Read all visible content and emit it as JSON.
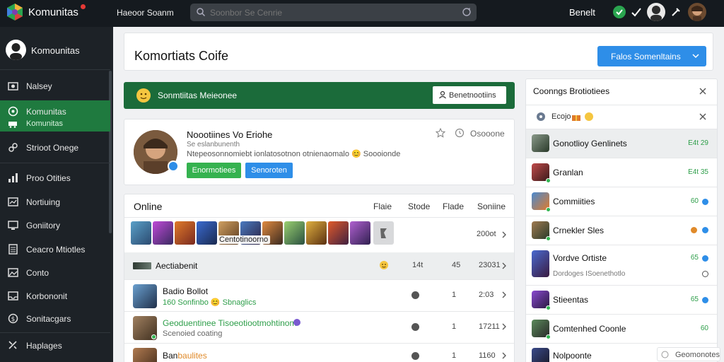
{
  "topbar": {
    "brand": "Komunitas",
    "nav": "Haeoor Soanm",
    "search_placeholder": "Soonbor Se Cenrie",
    "user_name": "Benelt"
  },
  "sidebar": {
    "profile_name": "Komounitas",
    "items": [
      {
        "label": "Nalsey"
      },
      {
        "label": "Komunitas",
        "sub": "Komunitas"
      },
      {
        "label": "Strioot Onege"
      },
      {
        "label": "Proo Otities"
      },
      {
        "label": "Nortiuing"
      },
      {
        "label": "Goniitory"
      },
      {
        "label": "Ceacro Mtiotles"
      },
      {
        "label": "Conto"
      },
      {
        "label": "Korbononit"
      },
      {
        "label": "Sonitacgars"
      },
      {
        "label": "Haplages"
      }
    ]
  },
  "header": {
    "title": "Komortiats Coife",
    "primary_button": "Falos Somenltains"
  },
  "banner": {
    "text": "Sonmtiitas Meieonee",
    "button": "Benetnootiins"
  },
  "profile_card": {
    "name": "Noootiines Vo Eriohe",
    "line1": "Se eslanbunenth",
    "line2": "Ntepeosonnomiebt ionlatosotnon otnienaomalo 😊 Soooionde",
    "button_green": "Enormotiees",
    "button_blue": "Senoroten",
    "stat": "Osooone"
  },
  "online": {
    "heading": "Online",
    "columns": [
      "Flaie",
      "Stode",
      "Flade",
      "Soniine"
    ],
    "thumb_label": "Centotinoorno",
    "count": "200ot",
    "rows": [
      {
        "name": "Aectiabenit",
        "c0": "14t",
        "c1": "45",
        "c2": "23031"
      },
      {
        "name": "Badio Bollot",
        "sub": "160 Sonfinbo 😊 Sbnaglics",
        "c1": "1",
        "c2": "2:03"
      },
      {
        "name": "Geoduentinee Tisoeotiootmohtinom",
        "sub": "Scenoied coating",
        "c1": "1",
        "c2": "17211"
      },
      {
        "name": "Ban",
        "name_hl": "baulites",
        "c1": "1",
        "c2": "1160"
      }
    ]
  },
  "right_panel": {
    "title": "Coonngs Brotiotiees",
    "filter_label": "Ecojo",
    "items": [
      {
        "name": "Gonotlioy Genlinets",
        "value": "E4t 29"
      },
      {
        "name": "Granlan",
        "value": "E4t 35"
      },
      {
        "name": "Commiities",
        "value": "60"
      },
      {
        "name": "Crnekler Sles",
        "value": ""
      },
      {
        "name": "Vordve Ortiste",
        "sub": "Dordoges ISoenethotlo",
        "value": "65"
      },
      {
        "name": "Stieentas",
        "value": "65"
      },
      {
        "name": "Comtenhed Coonle",
        "value": "60"
      },
      {
        "name": "Nolpoonte",
        "value": ""
      }
    ],
    "float_button": "Geomonotes"
  },
  "colors": {
    "accent_green": "#1f7a3f",
    "accent_blue": "#2e8ee8",
    "topbar": "#151a1f",
    "sidebar": "#1d2227"
  }
}
